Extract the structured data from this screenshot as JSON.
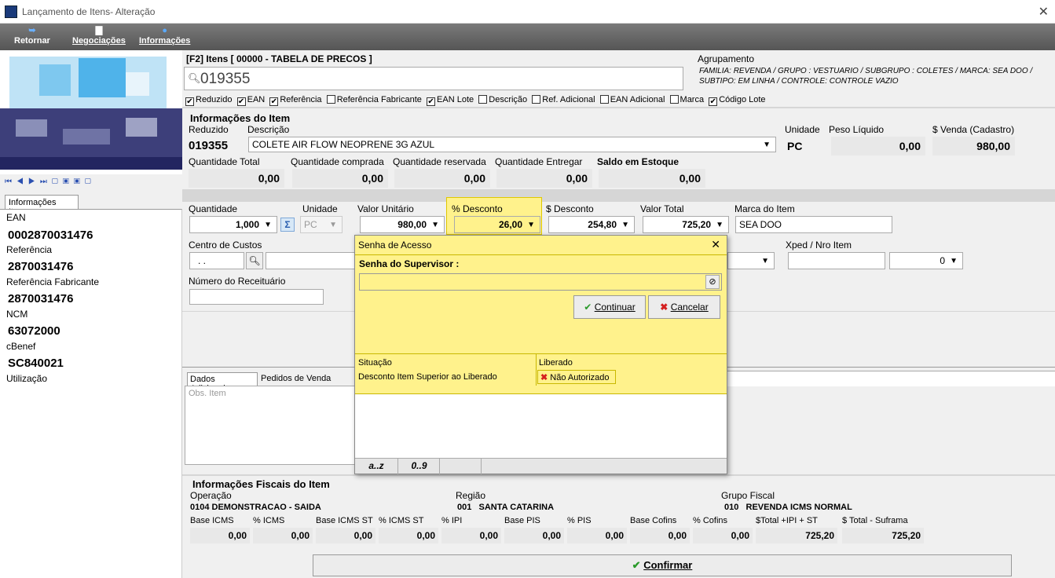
{
  "window": {
    "title": "Lançamento de Itens- Alteração",
    "close": "✕"
  },
  "toolbar": {
    "retornar": "Retornar",
    "negociacoes": "Negociações",
    "informacoes": "Informações"
  },
  "left": {
    "tab": "Informações Item",
    "fields": [
      {
        "label": "EAN",
        "value": "0002870031476"
      },
      {
        "label": "Referência",
        "value": "2870031476"
      },
      {
        "label": "Referência Fabricante",
        "value": "2870031476"
      },
      {
        "label": "NCM",
        "value": "63072000"
      },
      {
        "label": "cBenef",
        "value": "SC840021"
      },
      {
        "label": "Utilização",
        "value": ""
      }
    ]
  },
  "search": {
    "title": "[F2] Itens [ 00000 - TABELA DE PRECOS ]",
    "value": "019355",
    "checks": [
      {
        "label": "Reduzido",
        "checked": true
      },
      {
        "label": "EAN",
        "checked": true
      },
      {
        "label": "Referência",
        "checked": true
      },
      {
        "label": "Referência Fabricante",
        "checked": false
      },
      {
        "label": "EAN Lote",
        "checked": true
      },
      {
        "label": "Descrição",
        "checked": false
      },
      {
        "label": "Ref. Adicional",
        "checked": false
      },
      {
        "label": "EAN Adicional",
        "checked": false
      },
      {
        "label": "Marca",
        "checked": false
      },
      {
        "label": "Código Lote",
        "checked": true
      }
    ]
  },
  "agrupamento": {
    "label": "Agrupamento",
    "line1": "FAMILIA: REVENDA / GRUPO : VESTUARIO / SUBGRUPO : COLETES / MARCA: SEA DOO /",
    "line2": "SUBTIPO: EM LINHA / CONTROLE: CONTROLE VAZIO"
  },
  "item": {
    "section": "Informações do Item",
    "reduzido_label": "Reduzido",
    "descricao_label": "Descrição",
    "reduzido": "019355",
    "descricao": "COLETE AIR FLOW NEOPRENE 3G AZUL",
    "unidade_label": "Unidade",
    "unidade": "PC",
    "peso_label": "Peso Líquido",
    "peso": "0,00",
    "venda_label": "$ Venda (Cadastro)",
    "venda": "980,00",
    "qt_total_label": "Quantidade Total",
    "qt_total": "0,00",
    "qt_comprada_label": "Quantidade comprada",
    "qt_comprada": "0,00",
    "qt_reservada_label": "Quantidade reservada",
    "qt_reservada": "0,00",
    "qt_entregar_label": "Quantidade Entregar",
    "qt_entregar": "0,00",
    "saldo_label": "Saldo em Estoque",
    "saldo": "0,00"
  },
  "line": {
    "quantidade_label": "Quantidade",
    "quantidade": "1,000",
    "unidade_label": "Unidade",
    "unidade": "PC",
    "valor_unit_label": "Valor Unitário",
    "valor_unit": "980,00",
    "desconto_pct_label": "% Desconto",
    "desconto_pct": "26,00",
    "desconto_val_label": "$ Desconto",
    "desconto_val": "254,80",
    "valor_total_label": "Valor Total",
    "valor_total": "725,20",
    "marca_label": "Marca do Item",
    "marca": "SEA DOO",
    "centro_label": "Centro de Custos",
    "centro": ". .",
    "xped_label": "Xped / Nro Item",
    "nro_item": "0",
    "receituario_label": "Número do Receituário"
  },
  "tabs": {
    "dados": "Dados Adicionais",
    "pedidos": "Pedidos de Venda",
    "obs": "Obs. Item"
  },
  "dialog": {
    "title": "Senha de Acesso",
    "close": "✕",
    "senha_label": "Senha do Supervisor :",
    "continuar": "Continuar",
    "cancelar": "Cancelar",
    "col_situacao": "Situação",
    "col_liberado": "Liberado",
    "situacao": "Desconto Item Superior ao Liberado",
    "liberado": "Não Autorizado",
    "foot1": "a..z",
    "foot2": "0..9"
  },
  "fiscal": {
    "section": "Informações Fiscais do Item",
    "operacao_label": "Operação",
    "operacao": "0104  DEMONSTRACAO - SAIDA",
    "regiao_label": "Região",
    "regiao": "001   SANTA CATARINA",
    "grupo_label": "Grupo Fiscal",
    "grupo": "010   REVENDA ICMS NORMAL",
    "cols": [
      {
        "label": "Base ICMS",
        "value": "0,00"
      },
      {
        "label": "% ICMS",
        "value": "0,00"
      },
      {
        "label": "Base ICMS ST",
        "value": "0,00"
      },
      {
        "label": "% ICMS ST",
        "value": "0,00"
      },
      {
        "label": "% IPI",
        "value": "0,00"
      },
      {
        "label": "Base PIS",
        "value": "0,00"
      },
      {
        "label": "% PIS",
        "value": "0,00"
      },
      {
        "label": "Base Cofins",
        "value": "0,00"
      },
      {
        "label": "% Cofins",
        "value": "0,00"
      },
      {
        "label": "$Total +IPI + ST",
        "value": "725,20"
      },
      {
        "label": "$ Total - Suframa",
        "value": "725,20"
      }
    ]
  },
  "confirmar": "Confirmar",
  "colors": {
    "highlight": "#fff28c",
    "toolbar": "#666666",
    "accent": "#2a4fb0"
  }
}
